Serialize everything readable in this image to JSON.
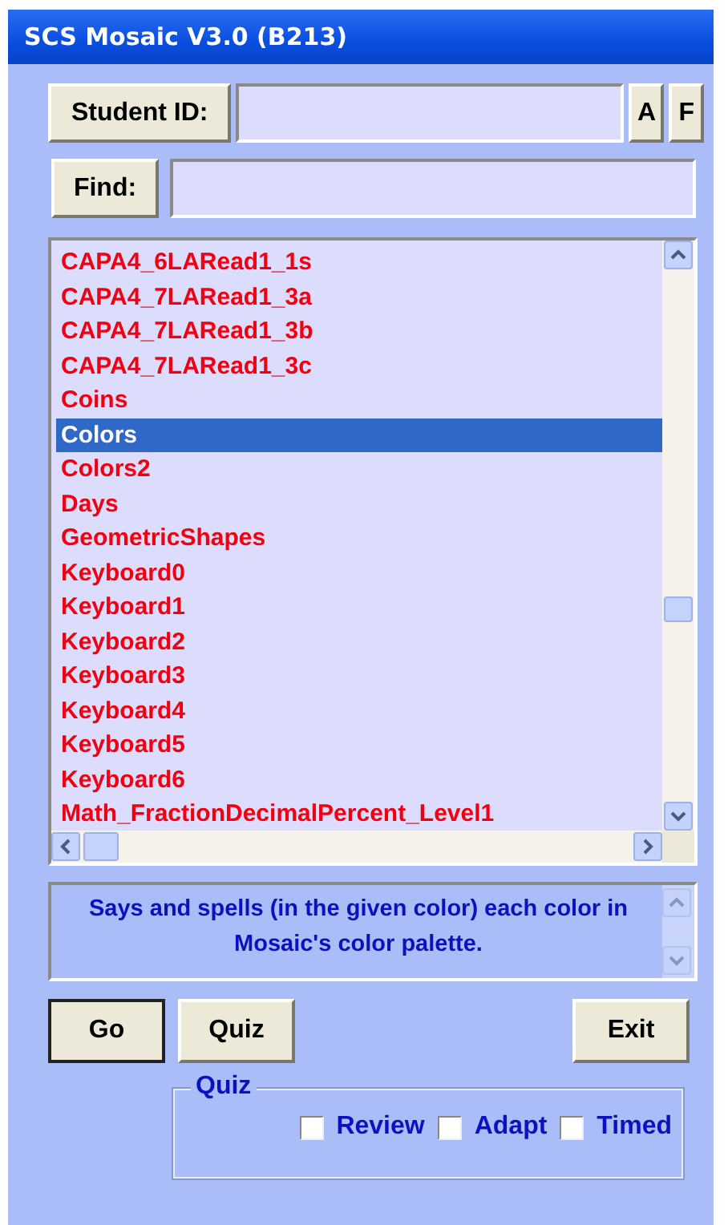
{
  "window": {
    "title": "SCS Mosaic V3.0 (B213)"
  },
  "student": {
    "button": "Student ID:",
    "buttons": [
      "A",
      "F"
    ]
  },
  "find": {
    "button": "Find:"
  },
  "list": {
    "items": [
      {
        "label": "CAPA4_6LARead1_1s",
        "selected": false
      },
      {
        "label": "CAPA4_7LARead1_3a",
        "selected": false
      },
      {
        "label": "CAPA4_7LARead1_3b",
        "selected": false
      },
      {
        "label": "CAPA4_7LARead1_3c",
        "selected": false
      },
      {
        "label": "Coins",
        "selected": false
      },
      {
        "label": "Colors",
        "selected": true
      },
      {
        "label": "Colors2",
        "selected": false
      },
      {
        "label": "Days",
        "selected": false
      },
      {
        "label": "GeometricShapes",
        "selected": false
      },
      {
        "label": "Keyboard0",
        "selected": false
      },
      {
        "label": "Keyboard1",
        "selected": false
      },
      {
        "label": "Keyboard2",
        "selected": false
      },
      {
        "label": "Keyboard3",
        "selected": false
      },
      {
        "label": "Keyboard4",
        "selected": false
      },
      {
        "label": "Keyboard5",
        "selected": false
      },
      {
        "label": "Keyboard6",
        "selected": false
      },
      {
        "label": "Math_FractionDecimalPercent_Level1",
        "selected": false
      }
    ]
  },
  "description": "Says and spells (in the given color) each color in Mosaic's color palette.",
  "buttons": [
    {
      "label": "Go",
      "kind": "default"
    },
    {
      "label": "Quiz",
      "kind": "normal"
    },
    {
      "label": "Exit",
      "kind": "right"
    }
  ],
  "quiz": {
    "title": "Quiz",
    "options": [
      {
        "label": "Review",
        "checked": false
      },
      {
        "label": "Adapt",
        "checked": false
      },
      {
        "label": "Timed",
        "checked": false
      }
    ]
  }
}
